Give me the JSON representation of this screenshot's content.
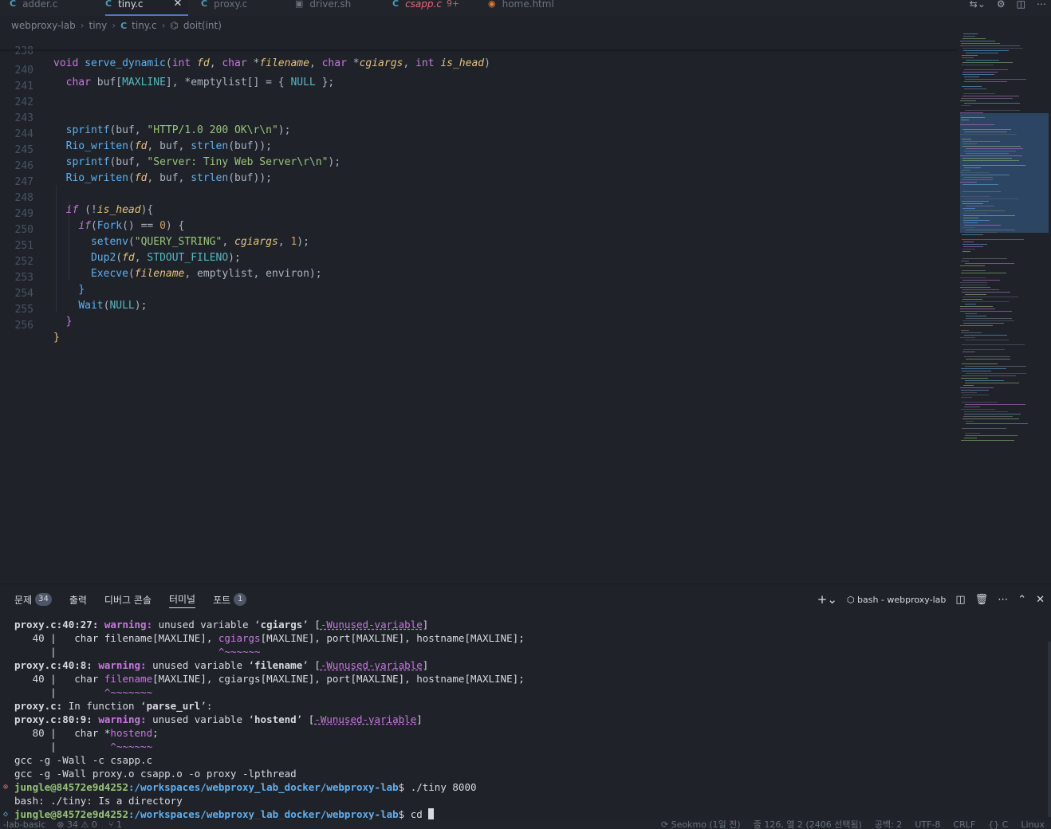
{
  "tabs": [
    {
      "label": "adder.c",
      "icon": "c-file-icon"
    },
    {
      "label": "tiny.c",
      "icon": "c-file-icon",
      "active": true
    },
    {
      "label": "proxy.c",
      "icon": "c-file-icon"
    },
    {
      "label": "driver.sh",
      "icon": "shell-file-icon"
    },
    {
      "label": "csapp.c",
      "icon": "c-file-icon",
      "badge": "9+"
    },
    {
      "label": "home.html",
      "icon": "html-file-icon"
    }
  ],
  "breadcrumb": {
    "root": "webproxy-lab",
    "folder": "tiny",
    "file": "tiny.c",
    "symbol": "doit(int)"
  },
  "editor": {
    "line_numbers": [
      "238",
      "240",
      "241",
      "242",
      "243",
      "244",
      "245",
      "246",
      "247",
      "248",
      "249",
      "250",
      "251",
      "252",
      "253",
      "254",
      "255",
      "256"
    ]
  },
  "panel": {
    "tabs": [
      {
        "label": "문제",
        "badge": "34"
      },
      {
        "label": "출력"
      },
      {
        "label": "디버그 콘솔"
      },
      {
        "label": "터미널",
        "active": true
      },
      {
        "label": "포트",
        "badge": "1"
      }
    ],
    "terminal_title": "bash - webproxy-lab"
  },
  "terminal": {
    "prompt_user": "jungle@84572e9d4252",
    "prompt_path": ":/workspaces/webproxy_lab_docker/webproxy-lab",
    "cmd_run": "$ ./tiny 8000",
    "error_out": "bash: ./tiny: Is a directory",
    "cmd_current": "$ cd ",
    "gcc1": "gcc -g -Wall -c csapp.c",
    "gcc2": "gcc -g -Wall proxy.o csapp.o -o proxy -lpthread"
  },
  "statusbar": {
    "left": [
      "-lab-basic",
      "⊗ 34 ⚠ 0",
      "⑂ 1"
    ],
    "right": [
      "⟳ Seokmo (1일 전)",
      "줄 126, 열 2 (2406 선택됨)",
      "공백: 2",
      "UTF-8",
      "CRLF",
      "{} C",
      "Linux"
    ]
  },
  "colors": {
    "accent": "#4d78cc",
    "editor_bg": "#1f2329",
    "keyword": "#c678dd",
    "string": "#98c379",
    "function": "#61afef",
    "number": "#d19a66"
  }
}
